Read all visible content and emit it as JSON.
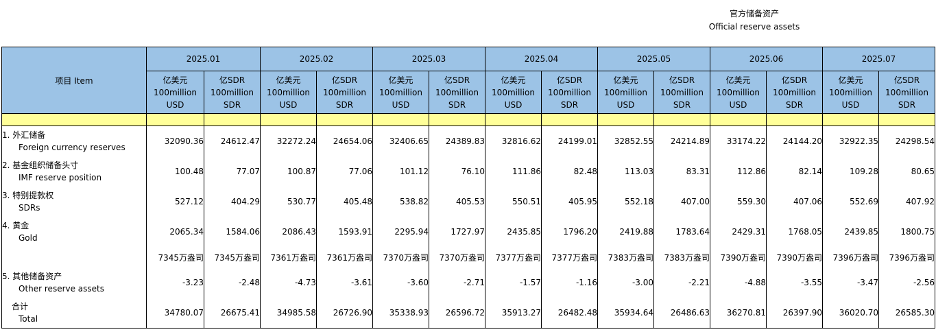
{
  "title": {
    "zh": "官方储备资产",
    "en": "Official reserve assets"
  },
  "header": {
    "item_label": "项目  Item",
    "months": [
      "2025.01",
      "2025.02",
      "2025.03",
      "2025.04",
      "2025.05",
      "2025.06",
      "2025.07"
    ],
    "unit_usd": [
      "亿美元",
      "100million",
      "USD"
    ],
    "unit_sdr": [
      "亿SDR",
      "100million",
      "SDR"
    ]
  },
  "rows": [
    {
      "zh": "1.  外汇储备",
      "en": "Foreign currency reserves",
      "values": [
        "32090.36",
        "24612.47",
        "32272.24",
        "24654.06",
        "32406.65",
        "24389.83",
        "32816.62",
        "24199.01",
        "32852.55",
        "24214.89",
        "33174.22",
        "24144.20",
        "32922.35",
        "24298.54"
      ]
    },
    {
      "zh": "2.  基金组织储备头寸",
      "en": "IMF reserve position",
      "values": [
        "100.48",
        "77.07",
        "100.87",
        "77.06",
        "101.12",
        "76.10",
        "111.86",
        "82.48",
        "113.03",
        "83.31",
        "112.86",
        "82.14",
        "109.28",
        "80.65"
      ]
    },
    {
      "zh": "3.  特别提款权",
      "en": "SDRs",
      "values": [
        "527.12",
        "404.29",
        "530.77",
        "405.48",
        "538.82",
        "405.53",
        "550.51",
        "405.95",
        "552.18",
        "407.00",
        "559.30",
        "407.06",
        "552.69",
        "407.92"
      ]
    },
    {
      "zh": "4.  黄金",
      "en": "Gold",
      "values": [
        "2065.34",
        "1584.06",
        "2086.43",
        "1593.91",
        "2295.94",
        "1727.97",
        "2435.85",
        "1796.20",
        "2419.88",
        "1783.64",
        "2429.31",
        "1768.05",
        "2439.85",
        "1800.75"
      ]
    },
    {
      "zh": "",
      "en": "",
      "values": [
        "7345万盎司",
        "7345万盎司",
        "7361万盎司",
        "7361万盎司",
        "7370万盎司",
        "7370万盎司",
        "7377万盎司",
        "7377万盎司",
        "7383万盎司",
        "7383万盎司",
        "7390万盎司",
        "7390万盎司",
        "7396万盎司",
        "7396万盎司"
      ]
    },
    {
      "zh": "5.  其他储备资产",
      "en": "Other reserve assets",
      "values": [
        "-3.23",
        "-2.48",
        "-4.73",
        "-3.61",
        "-3.60",
        "-2.71",
        "-1.57",
        "-1.16",
        "-3.00",
        "-2.21",
        "-4.88",
        "-3.55",
        "-3.47",
        "-2.56"
      ]
    },
    {
      "zh": "合计",
      "en": "Total",
      "values": [
        "34780.07",
        "26675.41",
        "34985.58",
        "26726.90",
        "35338.93",
        "26596.72",
        "35913.27",
        "26482.48",
        "35934.64",
        "26486.63",
        "36270.81",
        "26397.90",
        "36020.70",
        "26585.30"
      ]
    }
  ],
  "colors": {
    "header_bg": "#9cc3e6",
    "band_bg": "#ffff99"
  }
}
